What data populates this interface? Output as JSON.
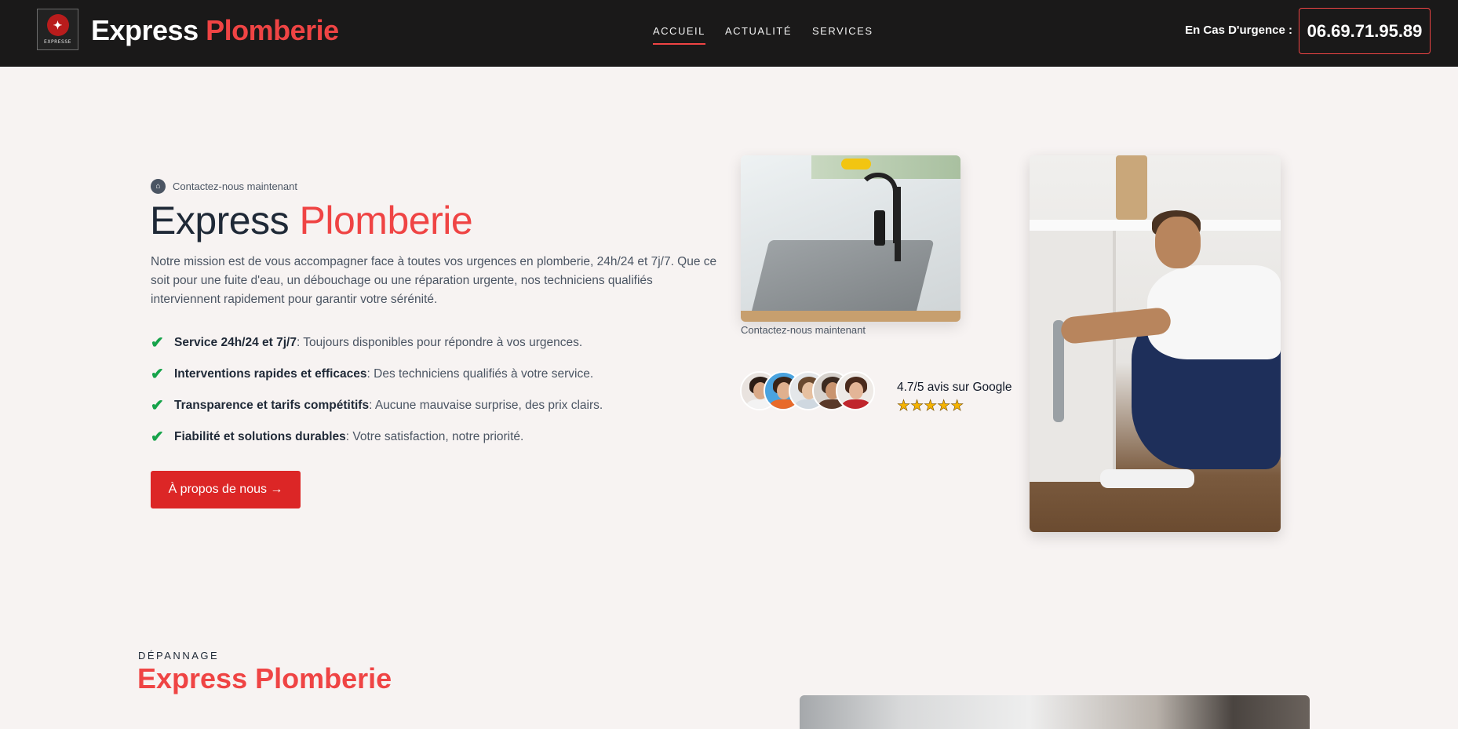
{
  "header": {
    "logo_caption": "EXPRESSE",
    "brand_white": "Express",
    "brand_accent": "Plomberie",
    "nav": [
      {
        "label": "ACCUEIL",
        "active": true
      },
      {
        "label": "ACTUALITÉ",
        "active": false
      },
      {
        "label": "SERVICES",
        "active": false
      }
    ],
    "urgence_label": "En Cas D'urgence :",
    "phone": "06.69.71.95.89"
  },
  "hero": {
    "contact_tag": "Contactez-nous maintenant",
    "title_dark": "Express",
    "title_accent": "Plomberie",
    "description": "Notre mission est de vous accompagner face à toutes vos urgences en plomberie, 24h/24 et 7j/7. Que ce soit pour une fuite d'eau, un débouchage ou une réparation urgente, nos techniciens qualifiés interviennent rapidement pour garantir votre sérénité.",
    "features": [
      {
        "bold": "Service 24h/24 et 7j/7",
        "text": ": Toujours disponibles pour répondre à vos urgences."
      },
      {
        "bold": "Interventions rapides et efficaces",
        "text": ": Des techniciens qualifiés à votre service."
      },
      {
        "bold": "Transparence et tarifs compétitifs",
        "text": ": Aucune mauvaise surprise, des prix clairs."
      },
      {
        "bold": "Fiabilité et solutions durables",
        "text": ": Votre satisfaction, notre priorité."
      }
    ],
    "button": "À propos de nous →",
    "image_caption": "Contactez-nous maintenant",
    "rating_text": "4.7/5 avis sur Google",
    "rating_stars": 5,
    "stars_glyphs": "★★★★★"
  },
  "section": {
    "eyebrow": "DÉPANNAGE",
    "title": "Express Plomberie"
  },
  "colors": {
    "accent": "#ef4444",
    "header_bg": "#1a1919",
    "button_bg": "#dc2626",
    "page_bg": "#f7f3f2"
  }
}
